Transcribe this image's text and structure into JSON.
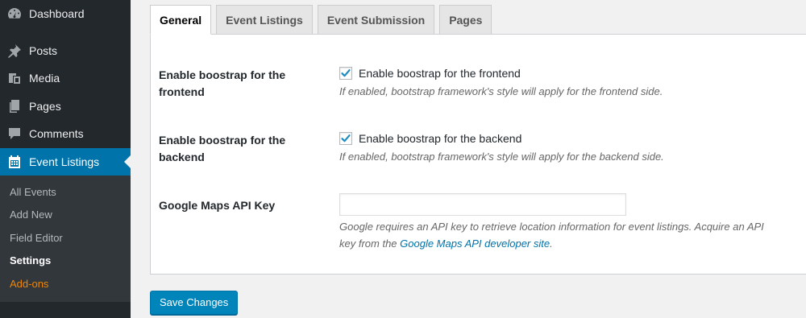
{
  "sidebar": {
    "menu": [
      {
        "label": "Dashboard",
        "icon": "dashboard-icon"
      },
      {
        "label": "Posts",
        "icon": "pin-icon"
      },
      {
        "label": "Media",
        "icon": "media-icon"
      },
      {
        "label": "Pages",
        "icon": "pages-icon"
      },
      {
        "label": "Comments",
        "icon": "comments-icon"
      },
      {
        "label": "Event Listings",
        "icon": "calendar-icon"
      }
    ],
    "submenu": [
      "All Events",
      "Add New",
      "Field Editor",
      "Settings",
      "Add-ons"
    ]
  },
  "tabs": [
    "General",
    "Event Listings",
    "Event Submission",
    "Pages"
  ],
  "settings": {
    "frontend": {
      "label_line1": "Enable boostrap for the",
      "label_line2": "frontend",
      "checkbox_label": "Enable boostrap for the frontend",
      "checked": true,
      "description": "If enabled, bootstrap framework's style will apply for the frontend side."
    },
    "backend": {
      "label_line1": "Enable boostrap for the",
      "label_line2": "backend",
      "checkbox_label": "Enable boostrap for the backend",
      "checked": true,
      "description": "If enabled, bootstrap framework's style will apply for the backend side."
    },
    "maps": {
      "label": "Google Maps API Key",
      "value": "",
      "description_line1": "Google requires an API key to retrieve location information for event listings. Acquire an API",
      "description_prefix": "key from the ",
      "link_text": "Google Maps API developer site",
      "description_suffix": "."
    }
  },
  "save_button": "Save Changes",
  "colors": {
    "sidebar_bg": "#23282d",
    "accent": "#0073aa",
    "button": "#0085ba",
    "addon": "#f18500"
  }
}
